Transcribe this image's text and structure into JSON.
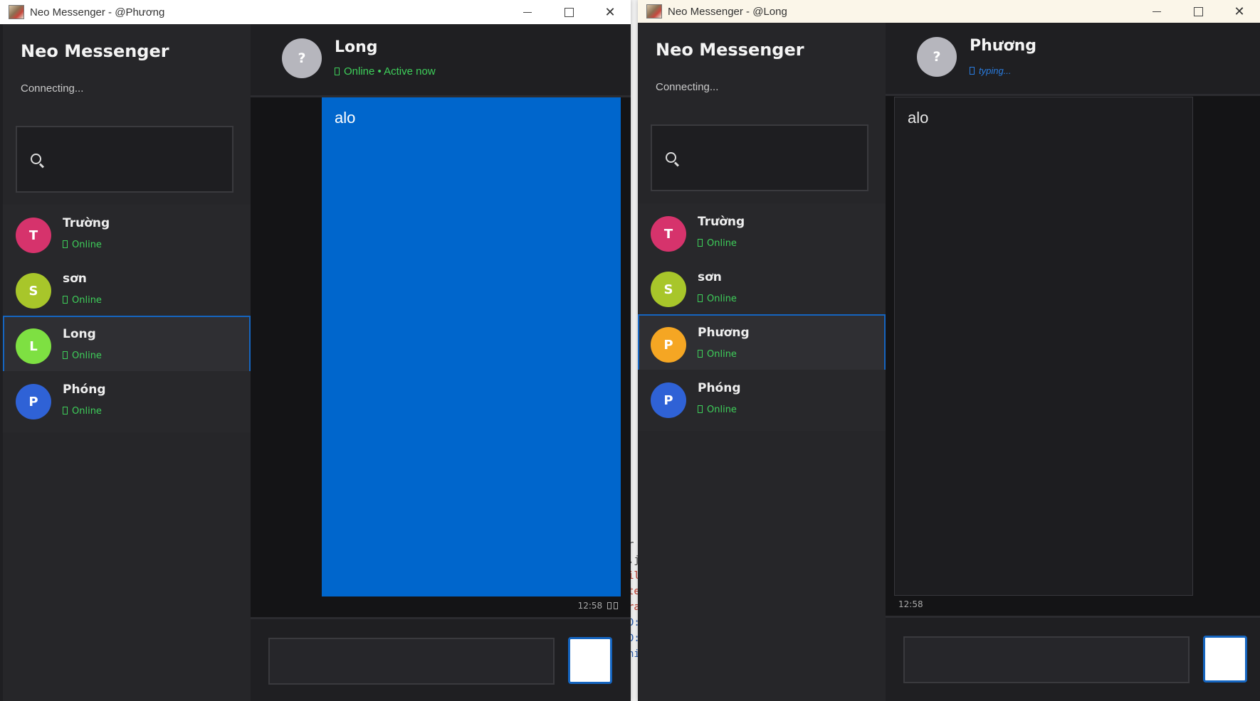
{
  "colors": {
    "accent": "#1565c0",
    "sent_bubble": "#0066cc",
    "online": "#3ecf5a",
    "typing": "#2a7de1"
  },
  "left_window": {
    "title": "Neo Messenger - @Phương",
    "sidebar": {
      "brand": "Neo Messenger",
      "connection_status": "Connecting...",
      "search_placeholder": "",
      "contacts": [
        {
          "initial": "T",
          "name": "Trường",
          "status": "Online",
          "color": "#d6336c"
        },
        {
          "initial": "S",
          "name": "sơn",
          "status": "Online",
          "color": "#a8c62a"
        },
        {
          "initial": "L",
          "name": "Long",
          "status": "Online",
          "color": "#7ee042",
          "active": true
        },
        {
          "initial": "P",
          "name": "Phóng",
          "status": "Online",
          "color": "#2f62d6"
        }
      ]
    },
    "chat": {
      "avatar": "?",
      "name": "Long",
      "status": "Online • Active now",
      "message": {
        "text": "alo",
        "time": "12:58"
      }
    }
  },
  "right_window": {
    "title": "Neo Messenger - @Long",
    "sidebar": {
      "brand": "Neo Messenger",
      "connection_status": "Connecting...",
      "search_placeholder": "",
      "contacts": [
        {
          "initial": "T",
          "name": "Trường",
          "status": "Online",
          "color": "#d6336c"
        },
        {
          "initial": "S",
          "name": "sơn",
          "status": "Online",
          "color": "#a8c62a"
        },
        {
          "initial": "P",
          "name": "Phương",
          "status": "Online",
          "color": "#f5a623",
          "active": true
        },
        {
          "initial": "P",
          "name": "Phóng",
          "status": "Online",
          "color": "#2f62d6"
        }
      ]
    },
    "chat": {
      "avatar": "?",
      "name": "Phương",
      "status": "typing...",
      "message": {
        "text": "alo",
        "time": "12:58"
      }
    }
  },
  "background_code_fragments": [
    "r",
    ".j",
    "il",
    "te",
    "ra",
    "D:",
    "D:",
    "hi"
  ]
}
